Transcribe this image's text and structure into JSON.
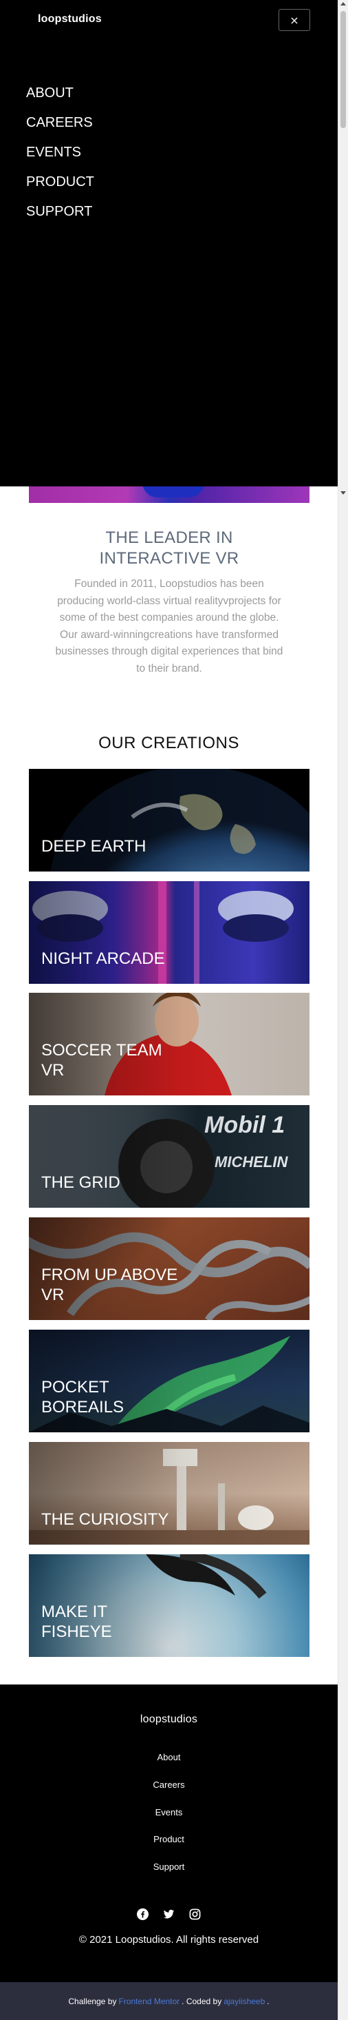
{
  "header": {
    "brand": "loopstudios",
    "close_label": "×"
  },
  "nav": {
    "items": [
      "ABOUT",
      "CAREERS",
      "EVENTS",
      "PRODUCT",
      "SUPPORT"
    ]
  },
  "leader": {
    "title": "THE LEADER IN INTERACTIVE VR",
    "text": "Founded in 2011, Loopstudios has been producing world-class virtual realityvprojects for some of the best companies around the globe. Our award-winningcreations have transformed businesses through digital experiences that bind to their brand."
  },
  "creations": {
    "title": "OUR CREATIONS",
    "items": [
      {
        "label": "DEEP EARTH"
      },
      {
        "label": "NIGHT ARCADE"
      },
      {
        "label": "SOCCER TEAM VR"
      },
      {
        "label": "THE GRID"
      },
      {
        "label": "FROM UP ABOVE VR"
      },
      {
        "label": "POCKET BOREAILS"
      },
      {
        "label": "THE CURIOSITY"
      },
      {
        "label": "MAKE IT FISHEYE"
      }
    ]
  },
  "footer": {
    "brand": "loopstudios",
    "links": [
      "About",
      "Careers",
      "Events",
      "Product",
      "Support"
    ],
    "socials": [
      "facebook-icon",
      "twitter-icon",
      "instagram-icon"
    ],
    "copyright": "© 2021 Loopstudios. All rights reserved"
  },
  "attribution": {
    "prefix": "Challenge by",
    "frontend_mentor": "Frontend Mentor",
    "coded_by": ". Coded by",
    "author": "ajayiisheeb",
    "suffix": "."
  },
  "colors": {
    "accent_link": "#4b7bd8",
    "footer_bg": "#000000",
    "attribution_bg": "#2c2d3d",
    "leader_title": "#5d6a7a"
  }
}
